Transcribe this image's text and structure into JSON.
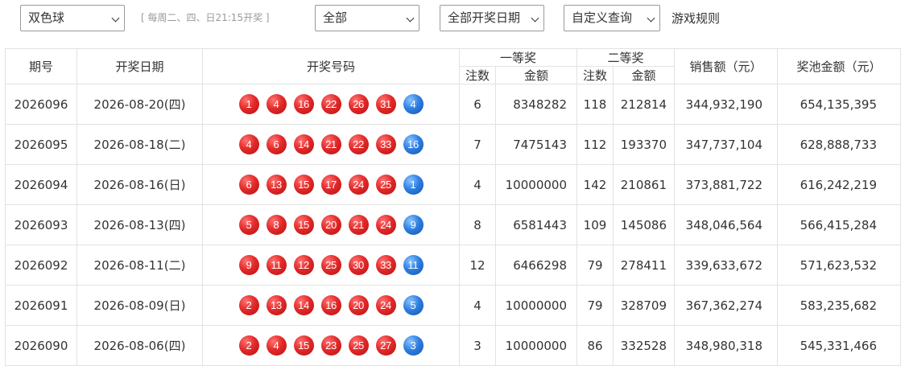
{
  "toolbar": {
    "lottery_select": "双色球",
    "schedule": "[ 每周二、四、日21:15开奖 ]",
    "scope_select": "全部",
    "date_select": "全部开奖日期",
    "custom_query_select": "自定义查询",
    "rules_link": "游戏规则"
  },
  "table": {
    "headers": {
      "issue": "期号",
      "date": "开奖日期",
      "numbers": "开奖号码",
      "first_prize": "一等奖",
      "second_prize": "二等奖",
      "count": "注数",
      "amount": "金额",
      "sales": "销售额（元）",
      "pool": "奖池金额（元）"
    },
    "rows": [
      {
        "issue": "2026096",
        "date": "2026-08-20(四)",
        "red": [
          "1",
          "4",
          "16",
          "22",
          "26",
          "31"
        ],
        "blue": "4",
        "first_count": "6",
        "first_amount": "8348282",
        "second_count": "118",
        "second_amount": "212814",
        "sales": "344,932,190",
        "pool": "654,135,395"
      },
      {
        "issue": "2026095",
        "date": "2026-08-18(二)",
        "red": [
          "4",
          "6",
          "14",
          "21",
          "22",
          "33"
        ],
        "blue": "16",
        "first_count": "7",
        "first_amount": "7475143",
        "second_count": "112",
        "second_amount": "193370",
        "sales": "347,737,104",
        "pool": "628,888,733"
      },
      {
        "issue": "2026094",
        "date": "2026-08-16(日)",
        "red": [
          "6",
          "13",
          "15",
          "17",
          "24",
          "25"
        ],
        "blue": "1",
        "first_count": "4",
        "first_amount": "10000000",
        "second_count": "142",
        "second_amount": "210861",
        "sales": "373,881,722",
        "pool": "616,242,219"
      },
      {
        "issue": "2026093",
        "date": "2026-08-13(四)",
        "red": [
          "5",
          "8",
          "15",
          "20",
          "21",
          "24"
        ],
        "blue": "9",
        "first_count": "8",
        "first_amount": "6581443",
        "second_count": "109",
        "second_amount": "145086",
        "sales": "348,046,564",
        "pool": "566,415,284"
      },
      {
        "issue": "2026092",
        "date": "2026-08-11(二)",
        "red": [
          "9",
          "11",
          "12",
          "25",
          "30",
          "33"
        ],
        "blue": "11",
        "first_count": "12",
        "first_amount": "6466298",
        "second_count": "79",
        "second_amount": "278411",
        "sales": "339,633,672",
        "pool": "571,623,532"
      },
      {
        "issue": "2026091",
        "date": "2026-08-09(日)",
        "red": [
          "2",
          "13",
          "14",
          "16",
          "20",
          "24"
        ],
        "blue": "5",
        "first_count": "4",
        "first_amount": "10000000",
        "second_count": "79",
        "second_amount": "328709",
        "sales": "367,362,274",
        "pool": "583,235,682"
      },
      {
        "issue": "2026090",
        "date": "2026-08-06(四)",
        "red": [
          "2",
          "4",
          "15",
          "23",
          "25",
          "27"
        ],
        "blue": "3",
        "first_count": "3",
        "first_amount": "10000000",
        "second_count": "86",
        "second_amount": "332528",
        "sales": "348,980,318",
        "pool": "545,331,466"
      }
    ]
  },
  "colors": {
    "red_ball": "#e32a2a",
    "blue_ball": "#2f7fe0",
    "border": "#e2e2e2"
  }
}
